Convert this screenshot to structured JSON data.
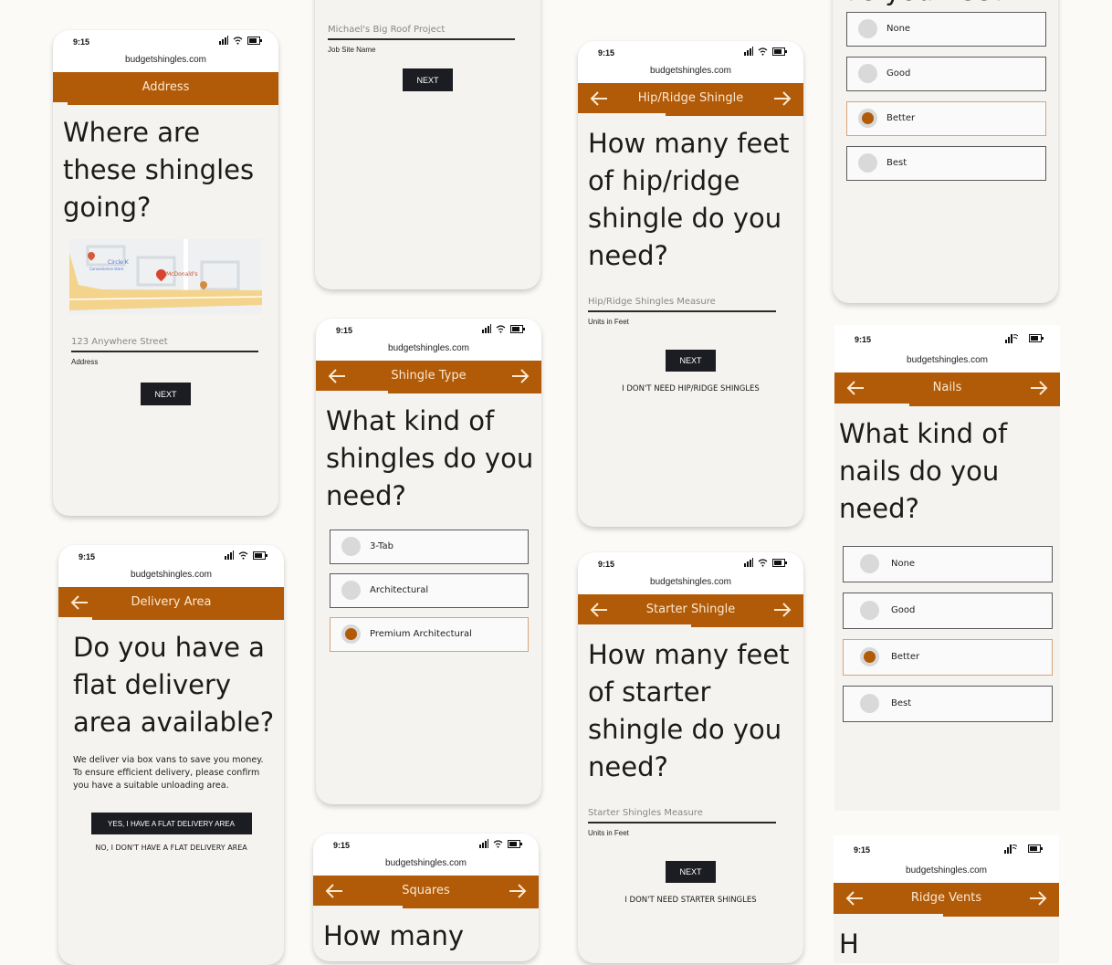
{
  "brand": {
    "accent": "#b15a07",
    "background": "#fcfaf7",
    "panel": "#f5f3ef",
    "button_dark": "#1c1d22"
  },
  "common": {
    "time": "9:15",
    "url": "budgetshingles.com",
    "next_label": "NEXT"
  },
  "screens": {
    "address": {
      "nav_title": "Address",
      "progress": 0.06,
      "question": "Where are these shingles going?",
      "map": {
        "labels": [
          "Circle K",
          "Convenience store",
          "McDonald's"
        ]
      },
      "input_placeholder": "123 Anywhere Street",
      "help": "Address",
      "next": "NEXT"
    },
    "job_site": {
      "input_placeholder": "Michael's Big Roof Project",
      "help": "Job Site Name",
      "next": "NEXT"
    },
    "shingle_type": {
      "nav_title": "Shingle Type",
      "progress": 0.32,
      "question": "What kind of shingles do you need?",
      "options": [
        {
          "label": "3-Tab",
          "selected": false
        },
        {
          "label": "Architectural",
          "selected": false
        },
        {
          "label": "Premium Architectural",
          "selected": true
        }
      ]
    },
    "squares": {
      "nav_title": "Squares",
      "progress": 0.4,
      "question": "How many"
    },
    "delivery": {
      "nav_title": "Delivery Area",
      "progress": 0.15,
      "question": "Do you have a flat delivery area available?",
      "body": "We deliver via box vans to save you money. To ensure efficient delivery, please confirm you have a suitable unloading area.",
      "yes": "YES, I HAVE A FLAT DELIVERY AREA",
      "no": "NO, I DON'T HAVE A FLAT DELIVERY AREA"
    },
    "hip_ridge": {
      "nav_title": "Hip/Ridge Shingle",
      "progress": 0.58,
      "question": "How many feet of hip/ridge shingle do you need?",
      "input_placeholder": "Hip/Ridge Shingles Measure",
      "help": "Units in Feet",
      "next": "NEXT",
      "skip": "I DON'T NEED HIP/RIDGE SHINGLES"
    },
    "starter": {
      "nav_title": "Starter Shingle",
      "progress": 0.5,
      "question": "How many feet of starter shingle do you need?",
      "input_placeholder": "Starter Shingles Measure",
      "help": "Units in Feet",
      "next": "NEXT",
      "skip": "I DON'T NEED STARTER SHINGLES"
    },
    "top_right": {
      "question_tail": "do you need?",
      "options": [
        {
          "label": "None",
          "selected": false
        },
        {
          "label": "Good",
          "selected": false
        },
        {
          "label": "Better",
          "selected": true
        },
        {
          "label": "Best",
          "selected": false
        }
      ]
    },
    "nails": {
      "nav_title": "Nails",
      "progress": 0.33,
      "question": "What kind of nails do you need?",
      "options": [
        {
          "label": "None",
          "selected": false
        },
        {
          "label": "Good",
          "selected": false
        },
        {
          "label": "Better",
          "selected": true
        },
        {
          "label": "Best",
          "selected": false
        }
      ]
    },
    "ridge_vents": {
      "nav_title": "Ridge Vents",
      "progress": 0.48,
      "question": "H"
    }
  }
}
